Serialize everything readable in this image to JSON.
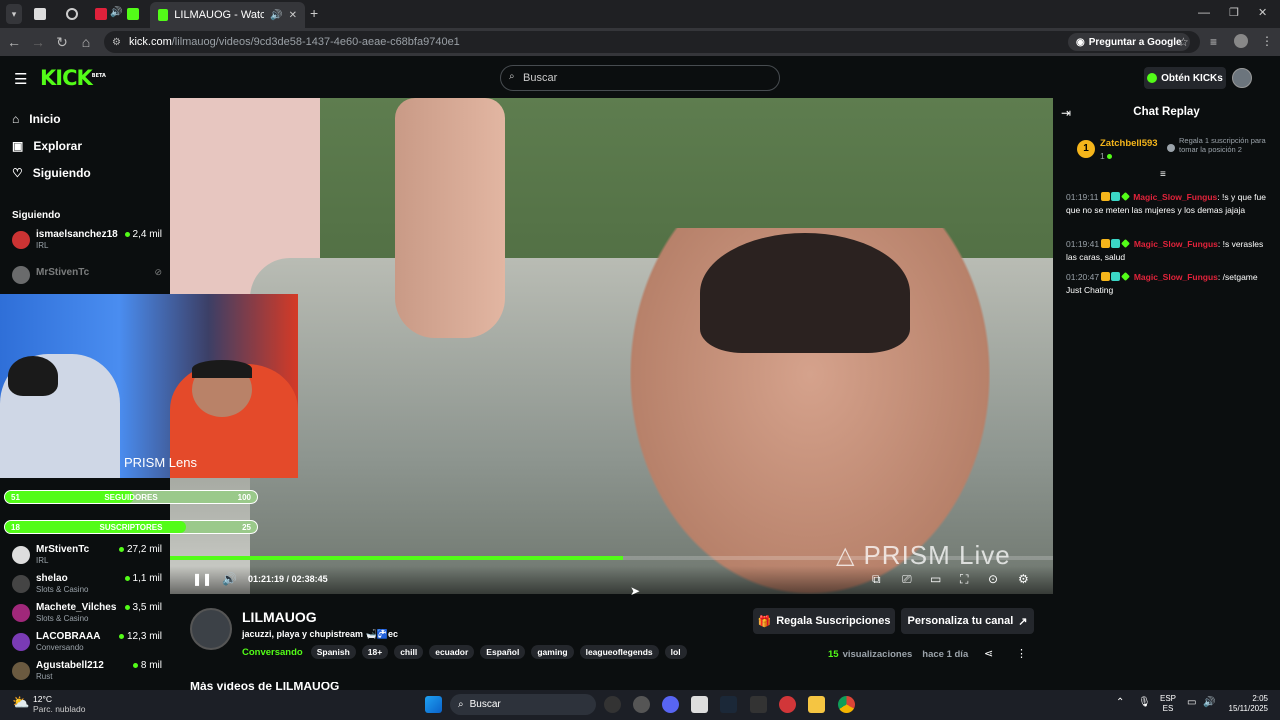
{
  "browser": {
    "active_tab_title": "LILMAUOG - Watch the VO",
    "url_domain": "kick.com",
    "url_path": "/lilmauog/videos/9cd3de58-1437-4e60-aeae-c68bfa9740e1",
    "ask_google": "Preguntar a Google",
    "new_tab": "+"
  },
  "header": {
    "logo": "KICK",
    "logo_beta": "BETA",
    "search_placeholder": "Buscar",
    "kicks_label": "Obtén KICKs"
  },
  "sidebar": {
    "nav": [
      {
        "label": "Inicio",
        "icon": "home-icon"
      },
      {
        "label": "Explorar",
        "icon": "explore-icon"
      },
      {
        "label": "Siguiendo",
        "icon": "heart-icon"
      }
    ],
    "following_title": "Siguiendo",
    "following": [
      {
        "name": "ismaelsanchez18",
        "category": "IRL",
        "viewers": "2,4 mil",
        "live": true
      },
      {
        "name": "MrStivenTc",
        "category": "",
        "viewers": "",
        "live": false
      },
      {
        "name": "MrStivenTc",
        "category": "IRL",
        "viewers": "27,2 mil",
        "live": true
      },
      {
        "name": "shelao",
        "category": "Slots & Casino",
        "viewers": "1,1 mil",
        "live": true
      },
      {
        "name": "Machete_Vilches",
        "category": "Slots & Casino",
        "viewers": "3,5 mil",
        "live": true
      },
      {
        "name": "LACOBRAAA",
        "category": "Conversando",
        "viewers": "12,3 mil",
        "live": true
      },
      {
        "name": "Agustabell212",
        "category": "Rust",
        "viewers": "8 mil",
        "live": true
      }
    ]
  },
  "overlay": {
    "lens_label": "PRISM Lens",
    "followers": {
      "left": "51",
      "label": "SEGUIDORES",
      "right": "100",
      "progress": 0.51
    },
    "subs": {
      "left": "18",
      "label": "SUSCRIPTORES",
      "right": "25",
      "progress": 0.72
    }
  },
  "video": {
    "watermark": "PRISM Live",
    "time_current": "01:21:19",
    "time_separator": "/",
    "time_total": "02:38:45",
    "progress": 0.513
  },
  "channel": {
    "name": "LILMAUOG",
    "title": "jacuzzi, playa y chupistream 🛁🚰ec",
    "category": "Conversando",
    "tags": [
      "Spanish",
      "18+",
      "chill",
      "ecuador",
      "Español",
      "gaming",
      "leagueoflegends",
      "lol"
    ],
    "gift_button": "Regala Suscripciones",
    "customize_button": "Personaliza tu canal",
    "views_count": "15",
    "views_label": "visualizaciones",
    "ago": "hace 1 día",
    "more_videos": "Más videos de LILMAUOG"
  },
  "chat": {
    "title": "Chat Replay",
    "top_gifter": {
      "rank": "1",
      "name": "Zatchbell593",
      "count": "1",
      "hint": "Regala 1 suscripción para tomar la posición 2"
    },
    "messages": [
      {
        "time": "01:19:11",
        "user": "Magic_Slow_Fungus",
        "text": "!s y que fue que no se meten las mujeres y los demas jajaja"
      },
      {
        "time": "01:19:41",
        "user": "Magic_Slow_Fungus",
        "text": "!s verasles las caras, salud"
      },
      {
        "time": "01:20:47",
        "user": "Magic_Slow_Fungus",
        "text": "/setgame Just Chating"
      }
    ]
  },
  "taskbar": {
    "temp": "12°C",
    "weather": "Parc. nublado",
    "search": "Buscar",
    "lang1": "ESP",
    "lang2": "ES",
    "time": "2:05",
    "date": "15/11/2025"
  },
  "colors": {
    "accent": "#53fc18",
    "bg": "#0b0e0f",
    "chat_user": "#e2233b",
    "gifter": "#f5b51b"
  }
}
